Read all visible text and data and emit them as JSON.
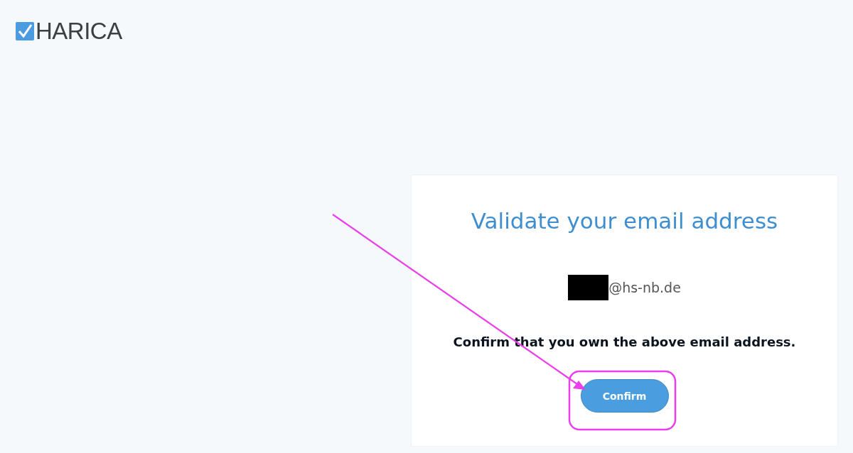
{
  "logo": {
    "text": "HARICA"
  },
  "card": {
    "title": "Validate your email address",
    "email": {
      "text": "@hs-nb.de",
      "redacted": true
    },
    "message": "Confirm that you own the above email address.",
    "button": "Confirm"
  },
  "annotations": {
    "arrow": true,
    "highlight_frame": true
  }
}
